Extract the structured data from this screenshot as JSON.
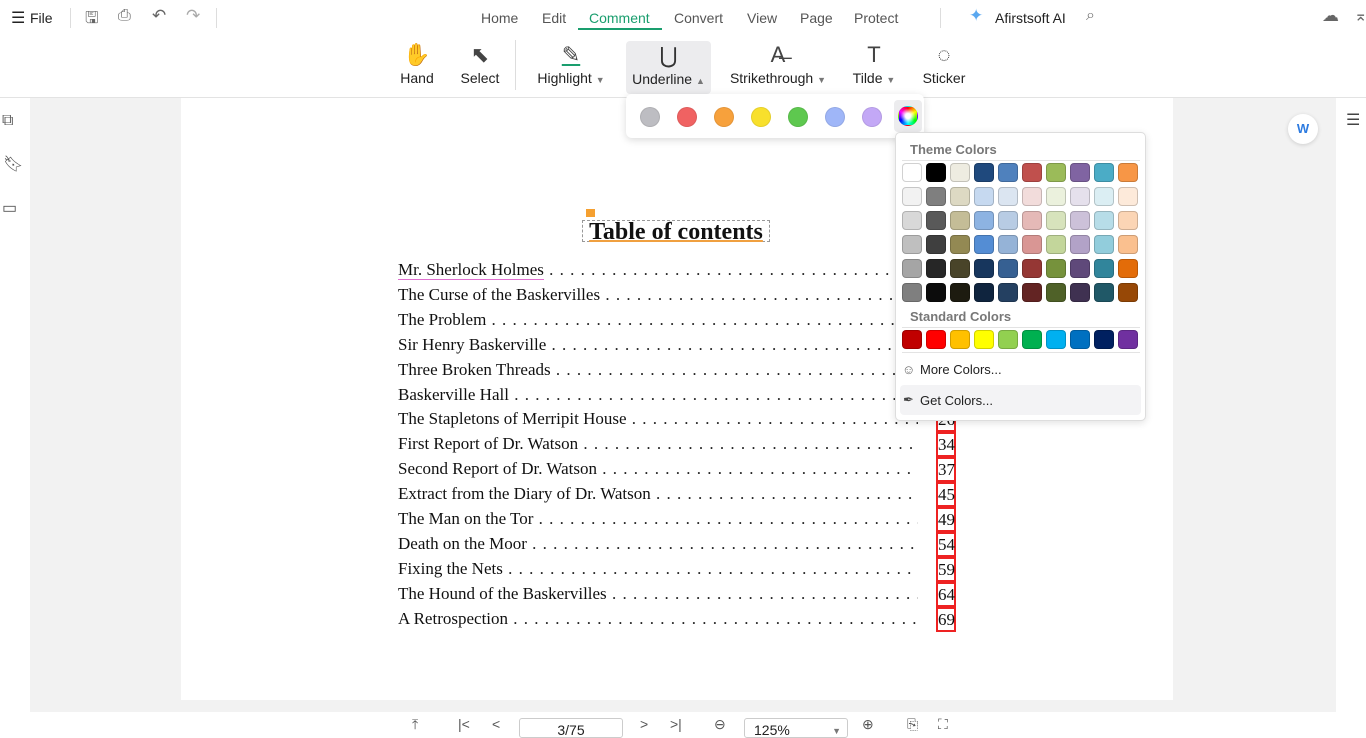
{
  "topbar": {
    "file": "File",
    "tabs": [
      "Home",
      "Edit",
      "Comment",
      "Convert",
      "View",
      "Page",
      "Protect"
    ],
    "active_tab": "Comment",
    "ai": "Afirstsoft AI"
  },
  "toolbar": {
    "hand": "Hand",
    "select": "Select",
    "highlight": "Highlight",
    "underline": "Underline",
    "strikethrough": "Strikethrough",
    "tilde": "Tilde",
    "sticker": "Sticker"
  },
  "quick_colors": [
    "#bdbdc2",
    "#f06262",
    "#f7a13c",
    "#f8e02c",
    "#5ec84f",
    "#9fb6f8",
    "#c3a8f6"
  ],
  "picker": {
    "theme_title": "Theme Colors",
    "standard_title": "Standard Colors",
    "more": "More Colors...",
    "get": "Get Colors...",
    "theme": [
      [
        "#FFFFFF",
        "#000000",
        "#EEECE1",
        "#1F497D",
        "#4F81BD",
        "#C0504D",
        "#9BBB59",
        "#8064A2",
        "#4BACC6",
        "#F79646"
      ],
      [
        "#F2F2F2",
        "#7F7F7F",
        "#DDD9C3",
        "#C6D9F0",
        "#DBE5F1",
        "#F2DCDB",
        "#EBF1DD",
        "#E5E0EC",
        "#DBEEF3",
        "#FDEADA"
      ],
      [
        "#D8D8D8",
        "#595959",
        "#C4BD97",
        "#8DB3E2",
        "#B8CCE4",
        "#E5B9B7",
        "#D7E3BC",
        "#CCC1D9",
        "#B7DDE8",
        "#FBD5B5"
      ],
      [
        "#BFBFBF",
        "#3F3F3F",
        "#938953",
        "#548DD4",
        "#95B3D7",
        "#D99694",
        "#C3D69B",
        "#B2A2C7",
        "#92CDDC",
        "#FAC08F"
      ],
      [
        "#A5A5A5",
        "#262626",
        "#494429",
        "#17365D",
        "#366092",
        "#953734",
        "#76923C",
        "#5F497A",
        "#31859B",
        "#E36C09"
      ],
      [
        "#7F7F7F",
        "#0C0C0C",
        "#1D1B10",
        "#0F243E",
        "#244061",
        "#632423",
        "#4F6128",
        "#3F3151",
        "#205867",
        "#974806"
      ]
    ],
    "standard": [
      "#C00000",
      "#FF0000",
      "#FFC000",
      "#FFFF00",
      "#92D050",
      "#00B050",
      "#00B0F0",
      "#0070C0",
      "#002060",
      "#7030A0"
    ]
  },
  "document": {
    "title": "Table of contents",
    "entries": [
      {
        "t": "Mr. Sherlock Holmes",
        "p": ""
      },
      {
        "t": "The Curse of the Baskervilles",
        "p": ""
      },
      {
        "t": "The Problem",
        "p": ""
      },
      {
        "t": "Sir Henry Baskerville",
        "p": ""
      },
      {
        "t": "Three Broken Threads",
        "p": ""
      },
      {
        "t": "Baskerville Hall",
        "p": ""
      },
      {
        "t": "The Stapletons of Merripit House",
        "p": "26"
      },
      {
        "t": "First Report of Dr. Watson",
        "p": "34"
      },
      {
        "t": "Second Report of Dr. Watson",
        "p": "37"
      },
      {
        "t": "Extract from the Diary of Dr. Watson",
        "p": "45"
      },
      {
        "t": "The Man on the Tor",
        "p": "49"
      },
      {
        "t": "Death on the Moor",
        "p": "54"
      },
      {
        "t": "Fixing the Nets",
        "p": "59"
      },
      {
        "t": "The Hound of the Baskervilles",
        "p": "64"
      },
      {
        "t": "A Retrospection",
        "p": "69"
      }
    ]
  },
  "bottom": {
    "page": "3/75",
    "zoom": "125%"
  }
}
